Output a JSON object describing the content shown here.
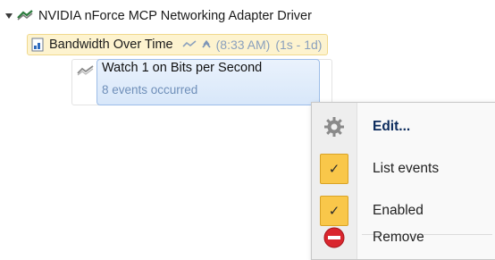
{
  "tree": {
    "root": {
      "label": "NVIDIA nForce MCP Networking Adapter Driver",
      "icon": "network-adapter-icon"
    },
    "monitor": {
      "label": "Bandwidth Over Time",
      "icon": "document-icon",
      "time": "(8:33 AM)",
      "range": "(1s - 1d)"
    },
    "watch": {
      "title": "Watch 1 on Bits per Second",
      "subtitle": "8 events occurred",
      "icon": "watch-signal-icon"
    }
  },
  "context_menu": {
    "items": [
      {
        "label": "Edit...",
        "icon": "gear-icon",
        "bold": true
      },
      {
        "label": "List events",
        "icon": "checkmark-icon",
        "checked": true
      },
      {
        "label": "Enabled",
        "icon": "checkmark-icon",
        "checked": true
      },
      {
        "label": "Remove",
        "icon": "remove-icon"
      }
    ],
    "check_glyph": "✓"
  },
  "colors": {
    "selection_fill": "#d8e7fa",
    "monitor_highlight": "#fdf3cf",
    "check_accent": "#f9c74a",
    "remove_red": "#d9262e"
  }
}
